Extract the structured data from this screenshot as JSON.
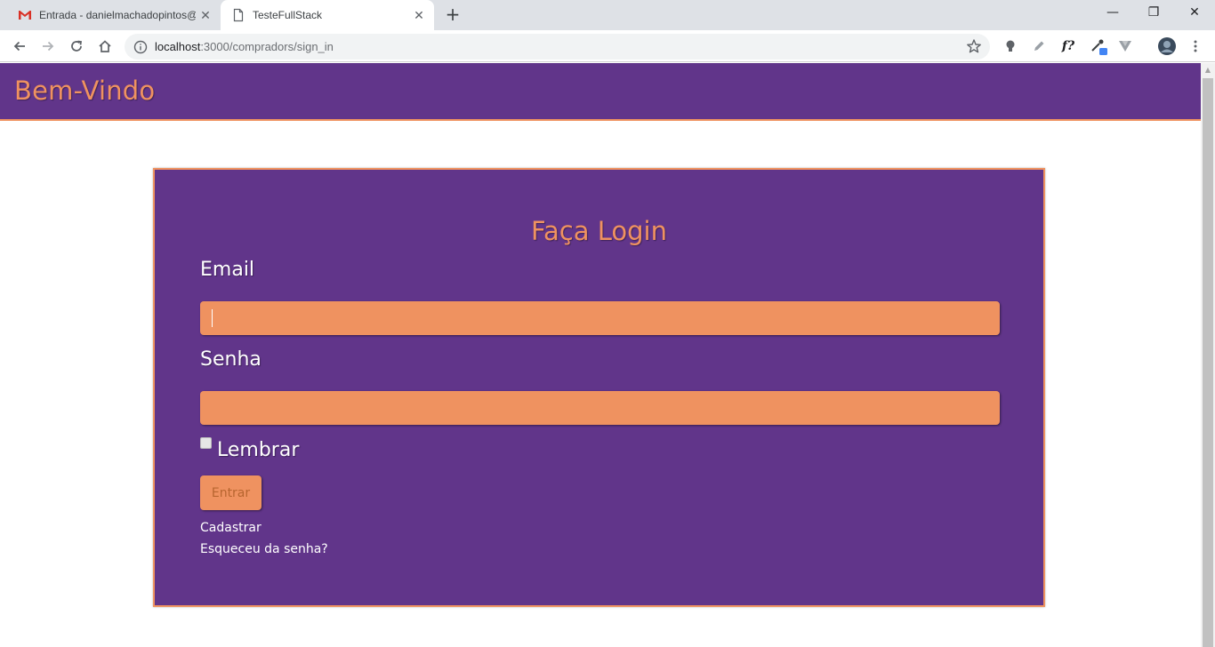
{
  "browser": {
    "tabs": [
      {
        "title": "Entrada - danielmachadopintos@",
        "close_glyph": "✕",
        "icon": "gmail-icon",
        "active": false
      },
      {
        "title": "TesteFullStack",
        "close_glyph": "✕",
        "icon": "page-icon",
        "active": true
      }
    ],
    "new_tab_glyph": "+",
    "window_controls": {
      "minimize": "—",
      "maximize": "❐",
      "close": "✕"
    },
    "url_host": "localhost",
    "url_path": ":3000/compradors/sign_in",
    "extension_f": "f?"
  },
  "page": {
    "brand": "Bem-Vindo",
    "login_title": "Faça Login",
    "email_label": "Email",
    "email_value": "",
    "password_label": "Senha",
    "password_value": "",
    "remember_label": "Lembrar",
    "remember_checked": false,
    "submit_label": "Entrar",
    "links": {
      "signup": "Cadastrar",
      "forgot_password": "Esqueceu da senha?"
    }
  },
  "colors": {
    "purple": "#61358a",
    "orange": "#ef9260",
    "chrome_bg": "#dee1e6"
  }
}
